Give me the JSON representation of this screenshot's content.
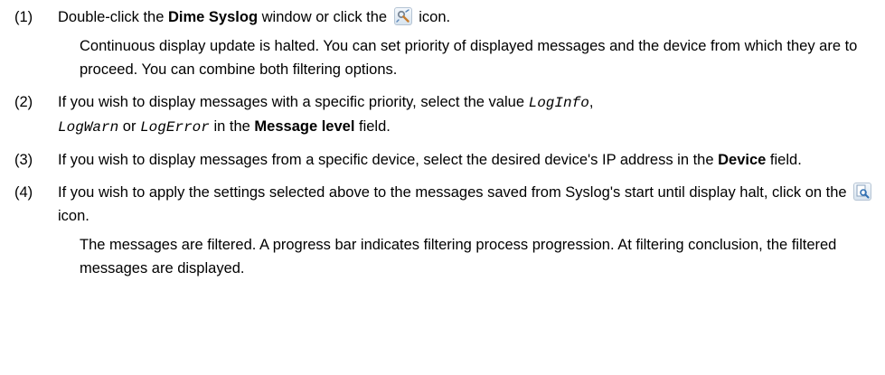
{
  "steps": [
    {
      "number": "(1)",
      "segments": [
        "Double-click the ",
        "Dime Syslog",
        " window or click the ",
        " icon."
      ],
      "result": "Continuous display update is halted. You can set priority of displayed messages and the device from which they are to proceed. You can combine both filtering options."
    },
    {
      "number": "(2)",
      "segments": [
        "If you wish to display messages with a specific priority, select the value ",
        "LogInfo",
        ",",
        "LogWarn",
        " or ",
        "LogError",
        " in the ",
        "Message level",
        " field."
      ]
    },
    {
      "number": "(3)",
      "segments": [
        "If you wish to display messages from a specific device, select the desired device's IP address in the ",
        "Device",
        " field."
      ]
    },
    {
      "number": "(4)",
      "segments": [
        "If you wish to apply the settings selected above to the messages saved from Syslog's start until display halt, click on the ",
        " icon."
      ],
      "result": "The messages are filtered. A progress bar indicates filtering process progression. At filtering conclusion, the filtered messages are displayed."
    }
  ],
  "icons": {
    "step1": "settings-tools-icon",
    "step4": "filter-magnifier-icon"
  }
}
